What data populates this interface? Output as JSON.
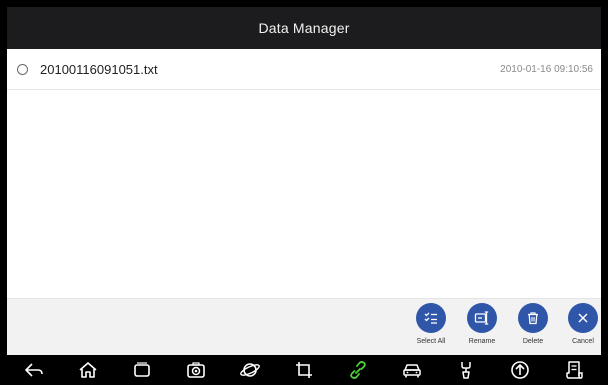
{
  "header": {
    "title": "Data Manager"
  },
  "files": [
    {
      "name": "20100116091051.txt",
      "time": "2010-01-16 09:10:56"
    }
  ],
  "actions": {
    "select_all": "Select All",
    "rename": "Rename",
    "delete": "Delete",
    "cancel": "Cancel"
  },
  "colors": {
    "accent": "#2f56a8",
    "header_bg": "#1c1c1e",
    "active_nav": "#4cd137"
  },
  "nav_icons": [
    "back-icon",
    "home-icon",
    "recent-apps-icon",
    "camera-icon",
    "browser-icon",
    "crop-icon",
    "link-icon",
    "vehicle-icon",
    "tools-icon",
    "upload-icon",
    "reports-icon"
  ]
}
